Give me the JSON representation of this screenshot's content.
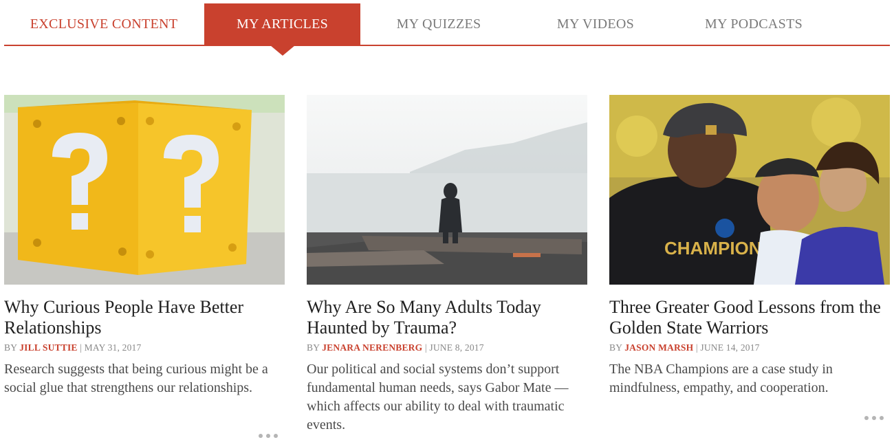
{
  "tabs": [
    {
      "label": "EXCLUSIVE CONTENT"
    },
    {
      "label": "MY ARTICLES"
    },
    {
      "label": "MY QUIZZES"
    },
    {
      "label": "MY VIDEOS"
    },
    {
      "label": "MY PODCASTS"
    }
  ],
  "active_tab": "MY ARTICLES",
  "colors": {
    "accent": "#c9412e"
  },
  "articles": [
    {
      "image": "question-block-photo",
      "title": "Why Curious People Have Better Relationships",
      "by": "BY",
      "author": "JILL SUTTIE",
      "separator": "|",
      "date": "MAY 31, 2017",
      "summary": "Research suggests that being curious might be a social glue that strengthens our relationships."
    },
    {
      "image": "person-at-lake-photo",
      "title": "Why Are So Many Adults Today Haunted by Trauma?",
      "by": "BY",
      "author": "JENARA NERENBERG",
      "separator": "|",
      "date": "JUNE 8, 2017",
      "summary": "Our political and social systems don’t support fundamental human needs, says Gabor Mate —which affects our ability to deal with traumatic events."
    },
    {
      "image": "warriors-celebration-photo",
      "title": "Three Greater Good Lessons from the Golden State Warriors",
      "by": "BY",
      "author": "JASON MARSH",
      "separator": "|",
      "date": "JUNE 14, 2017",
      "summary": "The NBA Champions are a case study in mindfulness, empathy, and cooperation."
    }
  ]
}
